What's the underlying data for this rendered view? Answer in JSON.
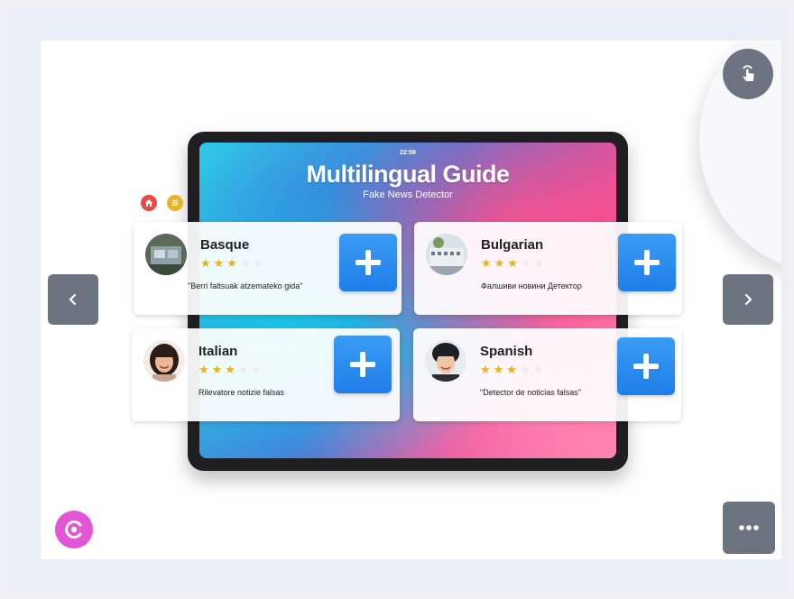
{
  "app": {
    "clock": "22:59",
    "title": "Multilingual Guide",
    "subtitle": "Fake News Detector"
  },
  "cards": [
    {
      "language": "Basque",
      "phrase": "\"Berri faltsuak atzemateko gida\"",
      "rating": 3,
      "max_rating": 5
    },
    {
      "language": "Bulgarian",
      "phrase": "Фалшиви новини Детектор",
      "rating": 3,
      "max_rating": 5
    },
    {
      "language": "Italian",
      "phrase": "Rilevatore notizie falsas",
      "rating": 3,
      "max_rating": 5
    },
    {
      "language": "Spanish",
      "phrase": "\"Detector de noticias falsas\"",
      "rating": 3,
      "max_rating": 5
    }
  ],
  "icons": {
    "prev": "chevron-left-icon",
    "next": "chevron-right-icon",
    "add": "plus-icon",
    "touch": "touch-icon",
    "more": "more-dots-icon",
    "brand": "brand-logo-icon",
    "home": "home-icon",
    "list": "list-icon"
  },
  "colors": {
    "nav_button": "#6d7380",
    "add_button": "#2a8cf0",
    "star": "#e9b21b",
    "brand": "#e255d6"
  }
}
